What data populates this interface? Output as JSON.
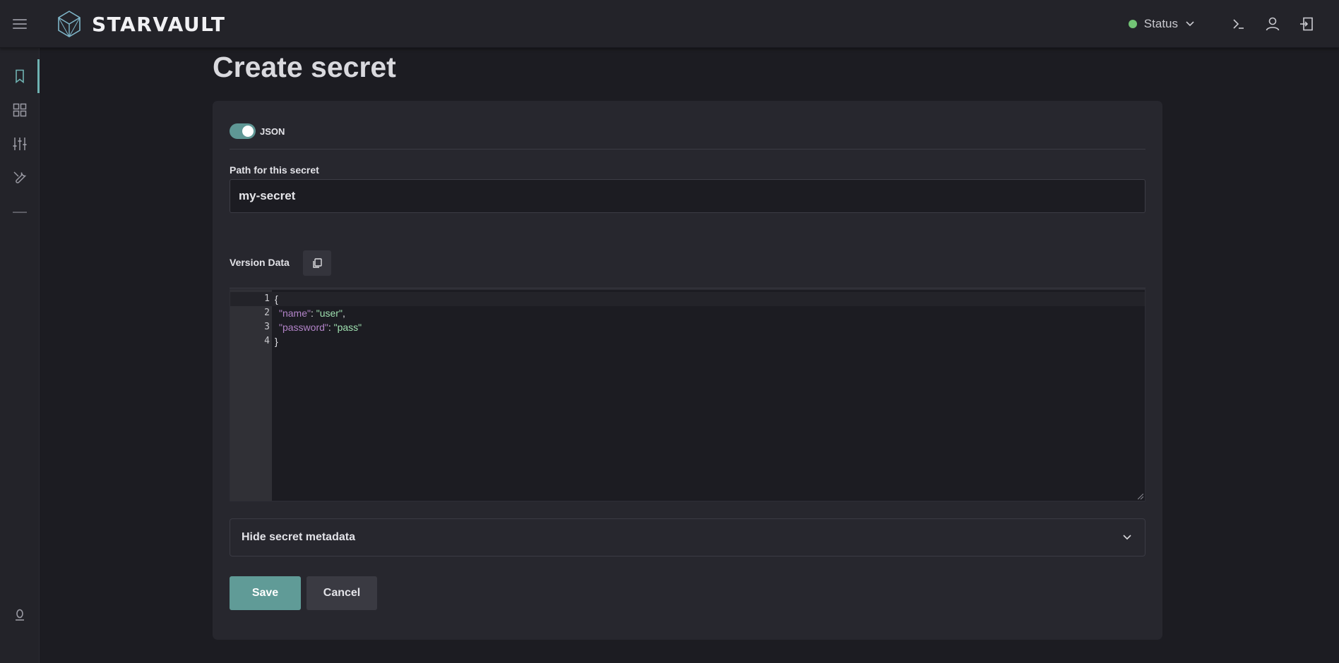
{
  "app": {
    "brand_name": "STARVAULT"
  },
  "header": {
    "status_label": "Status",
    "status_color": "#72c475"
  },
  "sidebar": {
    "items": [
      {
        "name": "bookmark",
        "active": true
      },
      {
        "name": "dashboard",
        "active": false
      },
      {
        "name": "settings-sliders",
        "active": false
      },
      {
        "name": "tools",
        "active": false
      },
      {
        "name": "collapse",
        "active": false
      }
    ]
  },
  "page": {
    "title": "Create secret"
  },
  "form": {
    "json_toggle_label": "JSON",
    "json_toggle_on": true,
    "path_label": "Path for this secret",
    "path_value": "my-secret",
    "version_data_label": "Version Data",
    "editor": {
      "line_numbers": [
        "1",
        "2",
        "3",
        "4"
      ],
      "lines": [
        {
          "open": "{"
        },
        {
          "key": "\"name\"",
          "sep": ": ",
          "value": "\"user\"",
          "tail": ","
        },
        {
          "key": "\"password\"",
          "sep": ": ",
          "value": "\"pass\"",
          "tail": ""
        },
        {
          "close": "}"
        }
      ]
    },
    "metadata_toggle_label": "Hide secret metadata",
    "save_label": "Save",
    "cancel_label": "Cancel"
  },
  "colors": {
    "accent": "#6fb2b2",
    "save_button": "#609b97"
  }
}
